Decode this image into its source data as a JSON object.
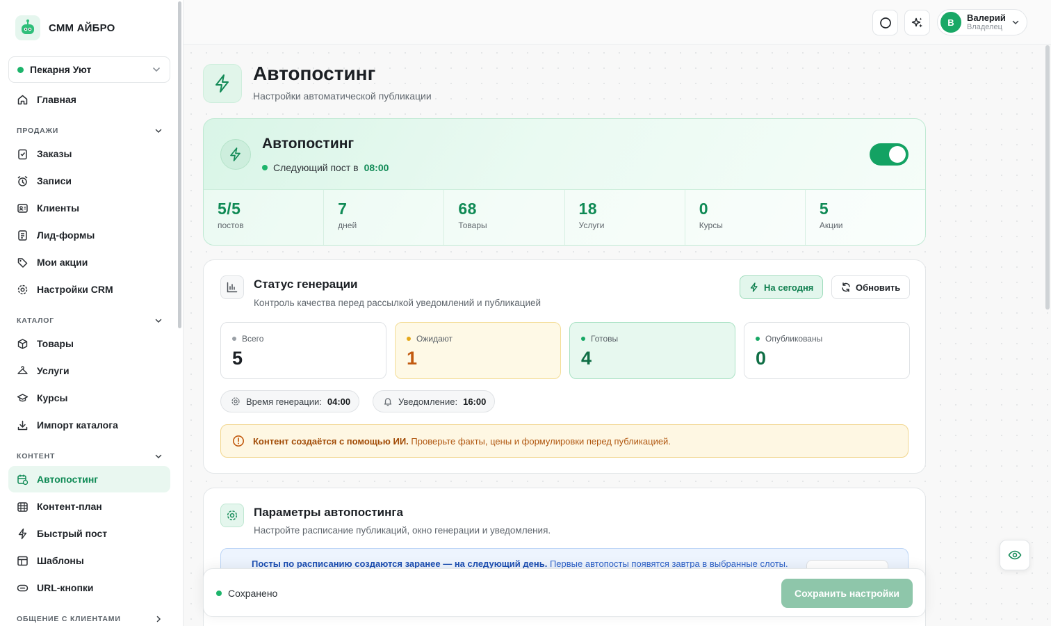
{
  "brand": {
    "name": "СММ АЙБРО",
    "logo_icon": "robot-icon"
  },
  "workspace": {
    "name": "Пекарня Уют",
    "status_color": "#1db46b"
  },
  "nav": {
    "home": "Главная",
    "sections": {
      "sales": "ПРОДАЖИ",
      "catalog": "КАТАЛОГ",
      "content": "КОНТЕНТ",
      "communication": "ОБЩЕНИЕ С КЛИЕНТАМИ"
    },
    "sales_items": [
      "Заказы",
      "Записи",
      "Клиенты",
      "Лид-формы",
      "Мои акции",
      "Настройки CRM"
    ],
    "catalog_items": [
      "Товары",
      "Услуги",
      "Курсы",
      "Импорт каталога"
    ],
    "content_items": [
      "Автопостинг",
      "Контент-план",
      "Быстрый пост",
      "Шаблоны",
      "URL-кнопки"
    ],
    "active_item": "Автопостинг"
  },
  "user": {
    "name": "Валерий",
    "role": "Владелец",
    "initial": "В"
  },
  "page": {
    "title": "Автопостинг",
    "subtitle": "Настройки автоматической публикации"
  },
  "hero": {
    "title": "Автопостинг",
    "next_label": "Следующий пост в",
    "next_time": "08:00",
    "enabled": true,
    "stats": [
      {
        "value": "5/5",
        "label": "постов"
      },
      {
        "value": "7",
        "label": "дней"
      },
      {
        "value": "68",
        "label": "Товары"
      },
      {
        "value": "18",
        "label": "Услуги"
      },
      {
        "value": "0",
        "label": "Курсы"
      },
      {
        "value": "5",
        "label": "Акции"
      }
    ]
  },
  "generation": {
    "title": "Статус генерации",
    "subtitle": "Контроль качества перед рассылкой уведомлений и публикацией",
    "today_button": "На сегодня",
    "refresh_button": "Обновить",
    "tiles": [
      {
        "label": "Всего",
        "value": "5"
      },
      {
        "label": "Ожидают",
        "value": "1"
      },
      {
        "label": "Готовы",
        "value": "4"
      },
      {
        "label": "Опубликованы",
        "value": "0"
      }
    ],
    "gen_time_label": "Время генерации:",
    "gen_time": "04:00",
    "notify_label": "Уведомление:",
    "notify_time": "16:00",
    "warning_bold": "Контент создаётся с помощью ИИ.",
    "warning_text": "Проверьте факты, цены и формулировки перед публикацией."
  },
  "params": {
    "title": "Параметры автопостинга",
    "subtitle": "Настройте расписание публикаций, окно генерации и уведомления.",
    "info_bold": "Посты по расписанию создаются заранее — на следующий день.",
    "info_text": "Первые автопосты появятся завтра в выбранные слоты."
  },
  "savebar": {
    "status": "Сохранено",
    "save_button": "Сохранить настройки"
  },
  "colors": {
    "accent": "#13a263",
    "accent_dark": "#0f8a55",
    "warning": "#c25a10"
  }
}
